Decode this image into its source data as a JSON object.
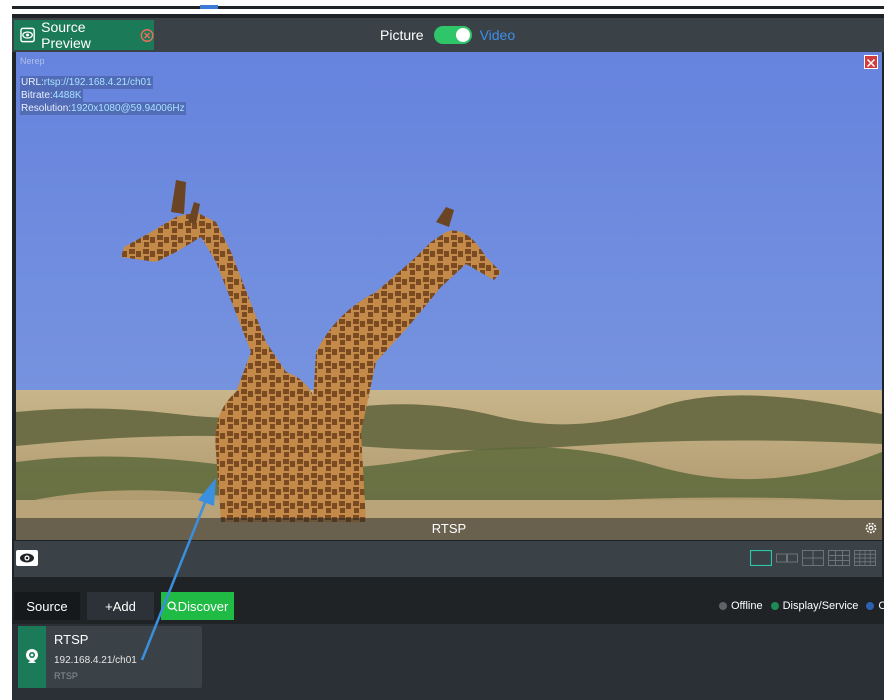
{
  "header": {
    "tab_label": "Source Preview",
    "toggle_left": "Picture",
    "toggle_right": "Video",
    "toggle_state": "on"
  },
  "preview": {
    "tiny_label": "Nerep",
    "info": {
      "url_key": "URL:",
      "url_val": "rtsp://192.168.4.21/ch01",
      "bitrate_key": "Bitrate:",
      "bitrate_val": "4488K",
      "res_key": "Resolution:",
      "res_val": "1920x1080@59.94006Hz"
    },
    "overlay_name": "RTSP"
  },
  "buttons": {
    "source": "Source",
    "add": "+Add",
    "discover": "Discover"
  },
  "legend": {
    "offline": "Offline",
    "display": "Display/Service",
    "third": "C"
  },
  "colors": {
    "accent_green": "#1b7a58",
    "discover_green": "#1fbb44",
    "toggle_green": "#2fc66a",
    "link_blue": "#3f8ee8",
    "offline_dot": "#5f6468",
    "display_dot": "#1d8a58",
    "third_dot": "#2f5fb0",
    "arrow_blue": "#3a8fde"
  },
  "source_card": {
    "title": "RTSP",
    "url": "192.168.4.21/ch01",
    "type": "RTSP",
    "icon": "webcam-icon"
  }
}
